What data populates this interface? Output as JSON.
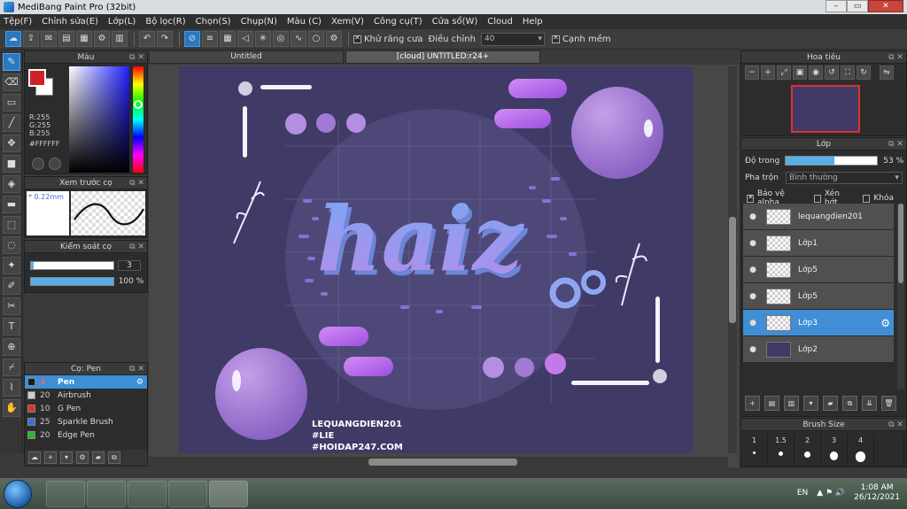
{
  "window": {
    "title": "MediBang Paint Pro (32bit)",
    "controls": [
      "–",
      "▭",
      "✕"
    ]
  },
  "menu": [
    "Tệp(F)",
    "Chỉnh sửa(E)",
    "Lớp(L)",
    "Bộ lọc(R)",
    "Chọn(S)",
    "Chụp(N)",
    "Màu (C)",
    "Xem(V)",
    "Công cụ(T)",
    "Cửa sổ(W)",
    "Cloud",
    "Help"
  ],
  "toolbar": {
    "antialias_label": "Khử răng cưa",
    "adjust_label": "Điều chỉnh",
    "adjust_value": "40",
    "sharpen_label": "Cạnh mềm"
  },
  "color_panel": {
    "title": "Màu",
    "r": "R:255",
    "g": "G:255",
    "b": "B:255",
    "hex": "#FFFFFF",
    "foreground": "#d0202a",
    "background": "#ffffff"
  },
  "preview_panel": {
    "title": "Xem trước cọ",
    "size": "0.22mm"
  },
  "brush_control": {
    "title": "Kiểm soát cọ",
    "size_value": "3",
    "opacity_value": "100 %",
    "size_fraction": 0.03,
    "opacity_fraction": 1.0
  },
  "brush_panel": {
    "title": "Cọ: Pen",
    "brushes": [
      {
        "size": "3",
        "name": "Pen",
        "color": "#1a1a1a"
      },
      {
        "size": "20",
        "name": "Airbrush",
        "color": "#cfcfcf"
      },
      {
        "size": "10",
        "name": "G Pen",
        "color": "#e0302a"
      },
      {
        "size": "25",
        "name": "Sparkle Brush",
        "color": "#3a6fe0"
      },
      {
        "size": "20",
        "name": "Edge Pen",
        "color": "#2eb82e"
      }
    ]
  },
  "canvas": {
    "tabs": [
      "Untitled",
      "[cloud] UNTITLED:r24+"
    ],
    "artwork_text": "haiz",
    "credit_lines": [
      "LEQUANGDIEN201",
      "#LIE",
      "#HOIDAP247.COM"
    ]
  },
  "navigator": {
    "title": "Hoa tiêu"
  },
  "layers": {
    "title": "Lớp",
    "opacity_label": "Độ trong",
    "opacity_value": "53 %",
    "opacity_fraction": 0.53,
    "blend_label": "Pha trộn",
    "blend_value": "Bình thường",
    "protect_alpha": "Bảo vệ alpha",
    "clip": "Xén bớt",
    "lock": "Khóa",
    "items": [
      {
        "name": "lequangdien201",
        "active": false
      },
      {
        "name": "Lớp1",
        "active": false
      },
      {
        "name": "Lớp5",
        "active": false
      },
      {
        "name": "Lớp5",
        "active": false
      },
      {
        "name": "Lớp3",
        "active": true
      },
      {
        "name": "Lớp2",
        "active": false
      }
    ]
  },
  "brush_size": {
    "title": "Brush Size",
    "sizes": [
      "1",
      "1.5",
      "2",
      "3",
      "4"
    ]
  },
  "taskbar": {
    "lang": "EN",
    "time": "1:08 AM",
    "date": "26/12/2021"
  }
}
